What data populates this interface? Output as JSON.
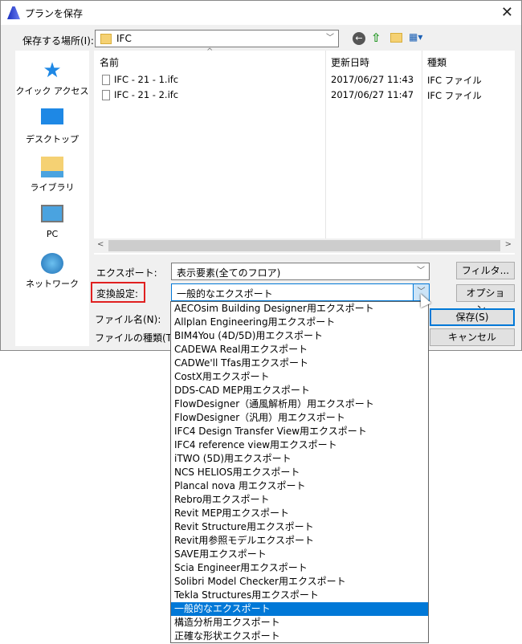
{
  "title": "プランを保存",
  "location_label": "保存する場所(I):",
  "location_value": "IFC",
  "sidebar": [
    "クイック アクセス",
    "デスクトップ",
    "ライブラリ",
    "PC",
    "ネットワーク"
  ],
  "columns": {
    "name": "名前",
    "date": "更新日時",
    "type": "種類"
  },
  "files": [
    {
      "name": "IFC - 21 - 1.ifc",
      "date": "2017/06/27 11:43",
      "type": "IFC ファイル"
    },
    {
      "name": "IFC - 21 - 2.ifc",
      "date": "2017/06/27 11:47",
      "type": "IFC ファイル"
    }
  ],
  "export_label": "エクスポート:",
  "export_value": "表示要素(全てのフロア)",
  "conv_label": "変換設定:",
  "conv_value": "一般的なエクスポート",
  "filename_label": "ファイル名(N):",
  "filetype_label": "ファイルの種類(T):",
  "buttons": {
    "filter": "フィルタ...",
    "options": "オプション...",
    "save": "保存(S)",
    "cancel": "キャンセル"
  },
  "options": [
    "AECOsim Building Designer用エクスポート",
    "Allplan Engineering用エクスポート",
    "BIM4You (4D/5D)用エクスポート",
    "CADEWA Real用エクスポート",
    "CADWe'll Tfas用エクスポート",
    "CostX用エクスポート",
    "DDS-CAD MEP用エクスポート",
    "FlowDesigner（通風解析用）用エクスポート",
    "FlowDesigner（汎用）用エクスポート",
    "IFC4 Design Transfer View用エクスポート",
    "IFC4 reference view用エクスポート",
    "iTWO (5D)用エクスポート",
    "NCS HELIOS用エクスポート",
    "Plancal nova 用エクスポート",
    "Rebro用エクスポート",
    "Revit MEP用エクスポート",
    "Revit Structure用エクスポート",
    "Revit用参照モデルエクスポート",
    "SAVE用エクスポート",
    "Scia Engineer用エクスポート",
    "Solibri Model Checker用エクスポート",
    "Tekla Structures用エクスポート",
    "一般的なエクスポート",
    "構造分析用エクスポート",
    "正確な形状エクスポート"
  ],
  "selected_index": 22
}
